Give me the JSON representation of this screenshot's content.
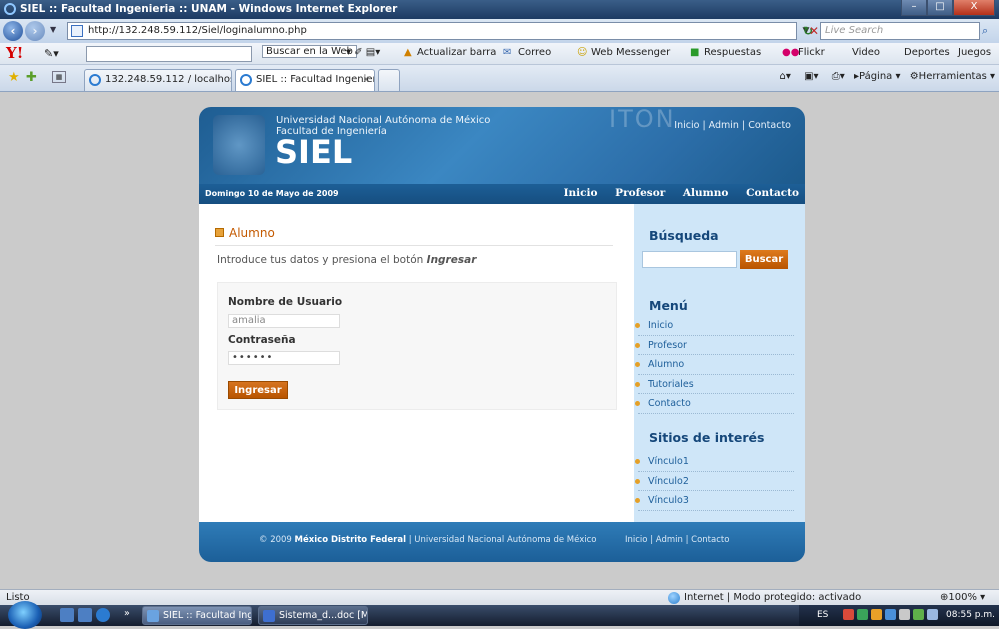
{
  "window": {
    "title": "SIEL :: Facultad Ingenieria :: UNAM - Windows Internet Explorer",
    "min": "–",
    "max": "□",
    "close": "X"
  },
  "address": {
    "url": "http://132.248.59.112/Siel/loginalumno.php",
    "search_placeholder": "Live Search"
  },
  "yahoo": {
    "search_btn": "Buscar en la Web",
    "items": [
      "Actualizar barra",
      "Correo",
      "Web Messenger",
      "Respuestas",
      "Flickr",
      "Video",
      "Deportes",
      "Juegos"
    ]
  },
  "tabs": [
    {
      "label": "132.248.59.112 / localhost ..."
    },
    {
      "label": "SIEL :: Facultad Ingenier...",
      "close": "x"
    }
  ],
  "commandbar": {
    "page": "Página",
    "tools": "Herramientas"
  },
  "site": {
    "header": {
      "university_line1": "Universidad Nacional Autónoma de México",
      "university_line2": "Facultad de Ingeniería",
      "logo": "SIEL",
      "watermark": "ITON"
    },
    "top_links": {
      "inicio": "Inicio",
      "admin": "Admin",
      "contacto": "Contacto",
      "sep": "|"
    },
    "date": "Domingo 10 de Mayo de 2009",
    "nav": [
      "Inicio",
      "Profesor",
      "Alumno",
      "Contacto"
    ],
    "section_title": "Alumno",
    "intro_text": "Introduce tus datos y presiona el botón",
    "intro_emph": "Ingresar",
    "login": {
      "user_label": "Nombre de Usuario",
      "user_value": "amalia",
      "pass_label": "Contraseña",
      "pass_value": "••••••",
      "submit": "Ingresar"
    },
    "sidebar": {
      "search_title": "Búsqueda",
      "search_button": "Buscar",
      "menu_title": "Menú",
      "menu_items": [
        "Inicio",
        "Profesor",
        "Alumno",
        "Tutoriales",
        "Contacto"
      ],
      "links_title": "Sitios de interés",
      "links": [
        "Vínculo1",
        "Vínculo2",
        "Vínculo3"
      ]
    },
    "footer": {
      "copy": "© 2009",
      "place": "México Distrito Federal",
      "sep": "|",
      "uni": "Universidad Nacional Autónoma de México",
      "inicio": "Inicio",
      "admin": "Admin",
      "contacto": "Contacto"
    }
  },
  "status": {
    "text": "Listo",
    "zone": "Internet | Modo protegido: activado",
    "zoom": "100%"
  },
  "taskbar": {
    "items": [
      "SIEL :: Facultad Inge...",
      "Sistema_d...doc [Mo..."
    ],
    "lang": "ES",
    "clock": "08:55 p.m.",
    "chevron": "»"
  }
}
